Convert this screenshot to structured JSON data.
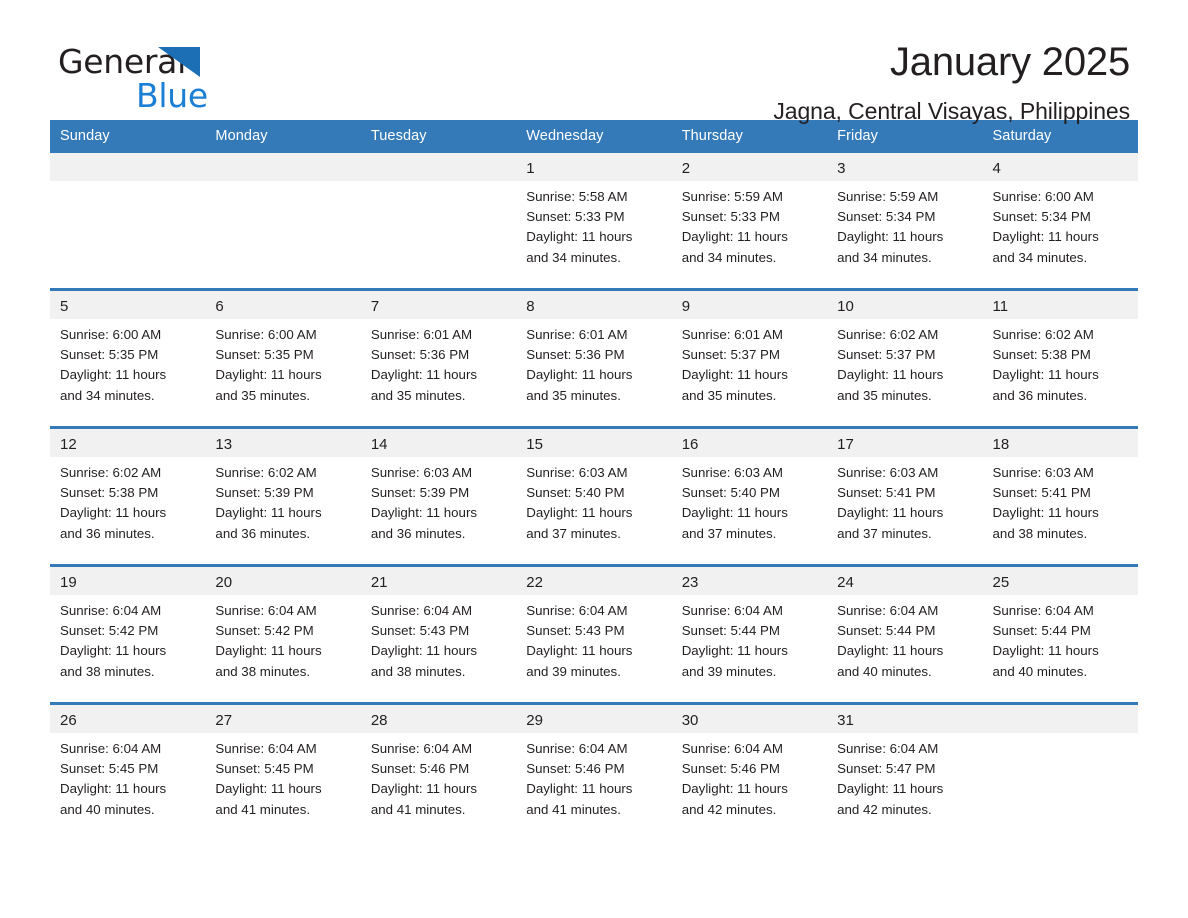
{
  "brand": {
    "name_first": "General",
    "name_second": "Blue",
    "triangle_color": "#1c6fb5",
    "blue_text_color": "#1c7fd6"
  },
  "header": {
    "title": "January 2025",
    "subtitle": "Jagna, Central Visayas, Philippines"
  },
  "theme": {
    "header_blue": "#357ab8",
    "daynum_band": "#f1f1f1",
    "text": "#231f20"
  },
  "weekday_headers": [
    "Sunday",
    "Monday",
    "Tuesday",
    "Wednesday",
    "Thursday",
    "Friday",
    "Saturday"
  ],
  "weeks": [
    [
      {
        "day": "",
        "sunrise": "",
        "sunset": "",
        "daylight_line1": "",
        "daylight_line2": ""
      },
      {
        "day": "",
        "sunrise": "",
        "sunset": "",
        "daylight_line1": "",
        "daylight_line2": ""
      },
      {
        "day": "",
        "sunrise": "",
        "sunset": "",
        "daylight_line1": "",
        "daylight_line2": ""
      },
      {
        "day": "1",
        "sunrise": "Sunrise: 5:58 AM",
        "sunset": "Sunset: 5:33 PM",
        "daylight_line1": "Daylight: 11 hours",
        "daylight_line2": "and 34 minutes."
      },
      {
        "day": "2",
        "sunrise": "Sunrise: 5:59 AM",
        "sunset": "Sunset: 5:33 PM",
        "daylight_line1": "Daylight: 11 hours",
        "daylight_line2": "and 34 minutes."
      },
      {
        "day": "3",
        "sunrise": "Sunrise: 5:59 AM",
        "sunset": "Sunset: 5:34 PM",
        "daylight_line1": "Daylight: 11 hours",
        "daylight_line2": "and 34 minutes."
      },
      {
        "day": "4",
        "sunrise": "Sunrise: 6:00 AM",
        "sunset": "Sunset: 5:34 PM",
        "daylight_line1": "Daylight: 11 hours",
        "daylight_line2": "and 34 minutes."
      }
    ],
    [
      {
        "day": "5",
        "sunrise": "Sunrise: 6:00 AM",
        "sunset": "Sunset: 5:35 PM",
        "daylight_line1": "Daylight: 11 hours",
        "daylight_line2": "and 34 minutes."
      },
      {
        "day": "6",
        "sunrise": "Sunrise: 6:00 AM",
        "sunset": "Sunset: 5:35 PM",
        "daylight_line1": "Daylight: 11 hours",
        "daylight_line2": "and 35 minutes."
      },
      {
        "day": "7",
        "sunrise": "Sunrise: 6:01 AM",
        "sunset": "Sunset: 5:36 PM",
        "daylight_line1": "Daylight: 11 hours",
        "daylight_line2": "and 35 minutes."
      },
      {
        "day": "8",
        "sunrise": "Sunrise: 6:01 AM",
        "sunset": "Sunset: 5:36 PM",
        "daylight_line1": "Daylight: 11 hours",
        "daylight_line2": "and 35 minutes."
      },
      {
        "day": "9",
        "sunrise": "Sunrise: 6:01 AM",
        "sunset": "Sunset: 5:37 PM",
        "daylight_line1": "Daylight: 11 hours",
        "daylight_line2": "and 35 minutes."
      },
      {
        "day": "10",
        "sunrise": "Sunrise: 6:02 AM",
        "sunset": "Sunset: 5:37 PM",
        "daylight_line1": "Daylight: 11 hours",
        "daylight_line2": "and 35 minutes."
      },
      {
        "day": "11",
        "sunrise": "Sunrise: 6:02 AM",
        "sunset": "Sunset: 5:38 PM",
        "daylight_line1": "Daylight: 11 hours",
        "daylight_line2": "and 36 minutes."
      }
    ],
    [
      {
        "day": "12",
        "sunrise": "Sunrise: 6:02 AM",
        "sunset": "Sunset: 5:38 PM",
        "daylight_line1": "Daylight: 11 hours",
        "daylight_line2": "and 36 minutes."
      },
      {
        "day": "13",
        "sunrise": "Sunrise: 6:02 AM",
        "sunset": "Sunset: 5:39 PM",
        "daylight_line1": "Daylight: 11 hours",
        "daylight_line2": "and 36 minutes."
      },
      {
        "day": "14",
        "sunrise": "Sunrise: 6:03 AM",
        "sunset": "Sunset: 5:39 PM",
        "daylight_line1": "Daylight: 11 hours",
        "daylight_line2": "and 36 minutes."
      },
      {
        "day": "15",
        "sunrise": "Sunrise: 6:03 AM",
        "sunset": "Sunset: 5:40 PM",
        "daylight_line1": "Daylight: 11 hours",
        "daylight_line2": "and 37 minutes."
      },
      {
        "day": "16",
        "sunrise": "Sunrise: 6:03 AM",
        "sunset": "Sunset: 5:40 PM",
        "daylight_line1": "Daylight: 11 hours",
        "daylight_line2": "and 37 minutes."
      },
      {
        "day": "17",
        "sunrise": "Sunrise: 6:03 AM",
        "sunset": "Sunset: 5:41 PM",
        "daylight_line1": "Daylight: 11 hours",
        "daylight_line2": "and 37 minutes."
      },
      {
        "day": "18",
        "sunrise": "Sunrise: 6:03 AM",
        "sunset": "Sunset: 5:41 PM",
        "daylight_line1": "Daylight: 11 hours",
        "daylight_line2": "and 38 minutes."
      }
    ],
    [
      {
        "day": "19",
        "sunrise": "Sunrise: 6:04 AM",
        "sunset": "Sunset: 5:42 PM",
        "daylight_line1": "Daylight: 11 hours",
        "daylight_line2": "and 38 minutes."
      },
      {
        "day": "20",
        "sunrise": "Sunrise: 6:04 AM",
        "sunset": "Sunset: 5:42 PM",
        "daylight_line1": "Daylight: 11 hours",
        "daylight_line2": "and 38 minutes."
      },
      {
        "day": "21",
        "sunrise": "Sunrise: 6:04 AM",
        "sunset": "Sunset: 5:43 PM",
        "daylight_line1": "Daylight: 11 hours",
        "daylight_line2": "and 38 minutes."
      },
      {
        "day": "22",
        "sunrise": "Sunrise: 6:04 AM",
        "sunset": "Sunset: 5:43 PM",
        "daylight_line1": "Daylight: 11 hours",
        "daylight_line2": "and 39 minutes."
      },
      {
        "day": "23",
        "sunrise": "Sunrise: 6:04 AM",
        "sunset": "Sunset: 5:44 PM",
        "daylight_line1": "Daylight: 11 hours",
        "daylight_line2": "and 39 minutes."
      },
      {
        "day": "24",
        "sunrise": "Sunrise: 6:04 AM",
        "sunset": "Sunset: 5:44 PM",
        "daylight_line1": "Daylight: 11 hours",
        "daylight_line2": "and 40 minutes."
      },
      {
        "day": "25",
        "sunrise": "Sunrise: 6:04 AM",
        "sunset": "Sunset: 5:44 PM",
        "daylight_line1": "Daylight: 11 hours",
        "daylight_line2": "and 40 minutes."
      }
    ],
    [
      {
        "day": "26",
        "sunrise": "Sunrise: 6:04 AM",
        "sunset": "Sunset: 5:45 PM",
        "daylight_line1": "Daylight: 11 hours",
        "daylight_line2": "and 40 minutes."
      },
      {
        "day": "27",
        "sunrise": "Sunrise: 6:04 AM",
        "sunset": "Sunset: 5:45 PM",
        "daylight_line1": "Daylight: 11 hours",
        "daylight_line2": "and 41 minutes."
      },
      {
        "day": "28",
        "sunrise": "Sunrise: 6:04 AM",
        "sunset": "Sunset: 5:46 PM",
        "daylight_line1": "Daylight: 11 hours",
        "daylight_line2": "and 41 minutes."
      },
      {
        "day": "29",
        "sunrise": "Sunrise: 6:04 AM",
        "sunset": "Sunset: 5:46 PM",
        "daylight_line1": "Daylight: 11 hours",
        "daylight_line2": "and 41 minutes."
      },
      {
        "day": "30",
        "sunrise": "Sunrise: 6:04 AM",
        "sunset": "Sunset: 5:46 PM",
        "daylight_line1": "Daylight: 11 hours",
        "daylight_line2": "and 42 minutes."
      },
      {
        "day": "31",
        "sunrise": "Sunrise: 6:04 AM",
        "sunset": "Sunset: 5:47 PM",
        "daylight_line1": "Daylight: 11 hours",
        "daylight_line2": "and 42 minutes."
      },
      {
        "day": "",
        "sunrise": "",
        "sunset": "",
        "daylight_line1": "",
        "daylight_line2": ""
      }
    ]
  ]
}
